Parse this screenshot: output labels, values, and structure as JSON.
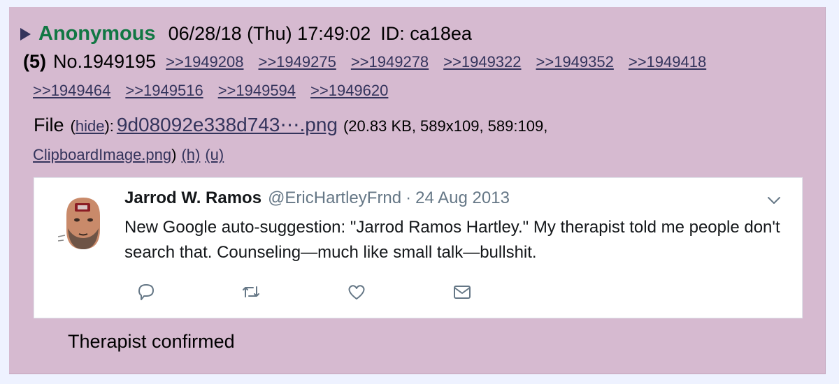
{
  "post": {
    "name": "Anonymous",
    "date": "06/28/18 (Thu) 17:49:02",
    "id_label": "ID: ca18ea",
    "reply_count": "(5)",
    "post_number": "No.1949195",
    "backlinks_row1": [
      ">>1949208",
      ">>1949275",
      ">>1949278",
      ">>1949322",
      ">>1949352",
      ">>1949418"
    ],
    "backlinks_row2": [
      ">>1949464",
      ">>1949516",
      ">>1949594",
      ">>1949620"
    ],
    "file": {
      "label": "File",
      "hide_open": "(",
      "hide": "hide",
      "hide_close": "):",
      "filename": "9d08092e338d743⋯.png",
      "info": "(20.83 KB, 589x109, 589:109,",
      "original_name": "ClipboardImage.png",
      "close_paren": ")",
      "h_link": "(h)",
      "u_link": "(u)"
    },
    "caption": "Therapist confirmed"
  },
  "tweet": {
    "name": "Jarrod W. Ramos",
    "handle": "@EricHartleyFrnd",
    "separator": "·",
    "date": "24 Aug 2013",
    "text": "New Google auto-suggestion: \"Jarrod Ramos Hartley.\" My therapist told me people don't search that. Counseling—much like small talk—bullshit.",
    "actions": [
      "reply-icon",
      "retweet-icon",
      "like-icon",
      "message-icon"
    ]
  },
  "colors": {
    "page_bg": "#eef2ff",
    "post_bg": "#d6bad0",
    "name_green": "#117743",
    "link_navy": "#34345c",
    "tweet_gray": "#657786"
  }
}
